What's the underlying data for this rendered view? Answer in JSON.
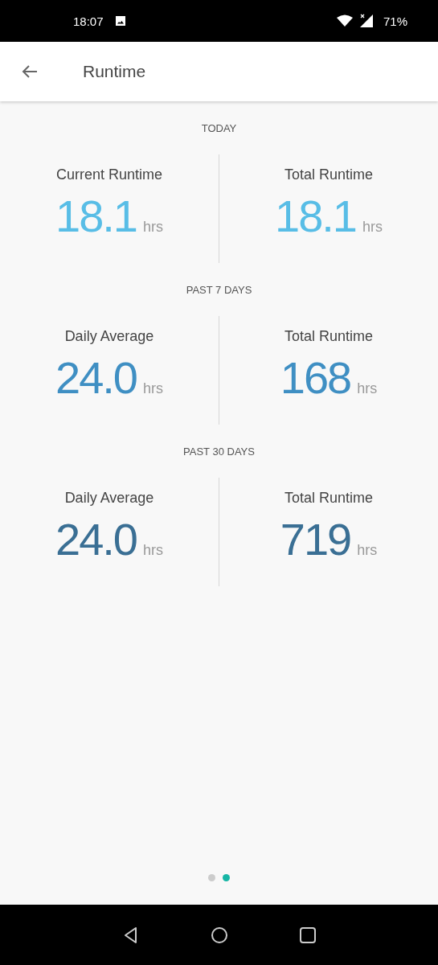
{
  "status_bar": {
    "time": "18:07",
    "battery": "71%"
  },
  "header": {
    "title": "Runtime"
  },
  "sections": [
    {
      "heading": "TODAY",
      "color": "#58bde6",
      "stats": [
        {
          "label": "Current Runtime",
          "value": "18.1",
          "unit": "hrs"
        },
        {
          "label": "Total Runtime",
          "value": "18.1",
          "unit": "hrs"
        }
      ]
    },
    {
      "heading": "PAST 7 DAYS",
      "color": "#3f8fc3",
      "stats": [
        {
          "label": "Daily Average",
          "value": "24.0",
          "unit": "hrs"
        },
        {
          "label": "Total Runtime",
          "value": "168",
          "unit": "hrs"
        }
      ]
    },
    {
      "heading": "PAST 30 DAYS",
      "color": "#3a6f94",
      "stats": [
        {
          "label": "Daily Average",
          "value": "24.0",
          "unit": "hrs"
        },
        {
          "label": "Total Runtime",
          "value": "719",
          "unit": "hrs"
        }
      ]
    }
  ],
  "page_dots": [
    {
      "selected": false
    },
    {
      "selected": true
    }
  ]
}
